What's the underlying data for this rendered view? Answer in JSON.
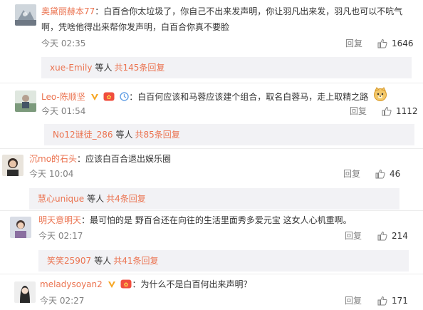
{
  "comments": [
    {
      "username": "奥黛丽赫本77",
      "text": "：白百合你太垃圾了，你自己不出来发声明，你让羽凡出来发，羽凡也可以不吭气",
      "text2": "啊，凭啥他得出来帮你发声明，白百合你真不要脸",
      "time": "今天 02:35",
      "reply_label": "回复",
      "likes": "1646",
      "replies": {
        "user": "xue-Emily",
        "mid": "等人",
        "link": "共145条回复"
      }
    },
    {
      "username": "Leo-陈顺坚",
      "text": "：白百何应该和马蓉应该建个组合，取名白蓉马，走上取精之路",
      "time": "今天 01:54",
      "reply_label": "回复",
      "likes": "1112",
      "replies": {
        "user": "No12谜徒_286",
        "mid": "等人",
        "link": "共85条回复"
      }
    },
    {
      "username": "沉mo的石头",
      "text": "：应该白百合退出娱乐圈",
      "time": "今天 10:04",
      "reply_label": "回复",
      "likes": "46",
      "replies": {
        "user": "慧心unique",
        "mid": "等人",
        "link": "共4条回复"
      }
    },
    {
      "username": "明天意明天",
      "text": "：最可怕的是 野百合还在向往的生活里面秀多爱元宝 这女人心机重啊。",
      "time": "今天 02:17",
      "reply_label": "回复",
      "likes": "214",
      "replies": {
        "user": "笑笑25907",
        "mid": "等人",
        "link": "共41条回复"
      }
    },
    {
      "username": "meladysoyan2",
      "text": "：为什么不是白百何出来声明？",
      "time": "今天 02:27",
      "reply_label": "回复",
      "likes": "171"
    }
  ],
  "colors": {
    "username": "#eb7350",
    "meta": "#808080",
    "reply_bg": "#f2f2f5"
  }
}
